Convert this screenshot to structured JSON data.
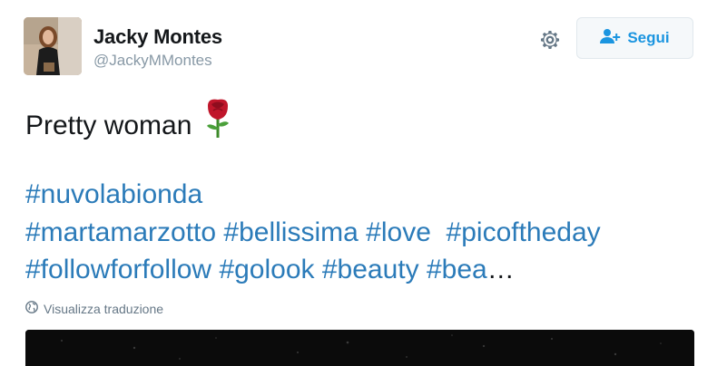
{
  "user": {
    "name": "Jacky Montes",
    "handle": "@JackyMMontes"
  },
  "actions": {
    "follow_label": "Segui",
    "settings_icon": "gear-icon",
    "follow_icon": "add-user-icon"
  },
  "tweet": {
    "text": "Pretty woman",
    "emoji": "rose-emoji",
    "hashtag_lines": [
      [
        "#nuvolabionda"
      ],
      [
        "#martamarzotto",
        "#bellissima",
        "#love",
        "#picoftheday"
      ],
      [
        "#followforfollow",
        "#golook",
        "#beauty",
        "#bea"
      ]
    ],
    "truncation": "…"
  },
  "translate": {
    "label": "Visualizza traduzione",
    "icon": "globe-icon"
  },
  "colors": {
    "link": "#2b7bb9",
    "follow_blue": "#1b95e0",
    "muted": "#8899a6"
  }
}
